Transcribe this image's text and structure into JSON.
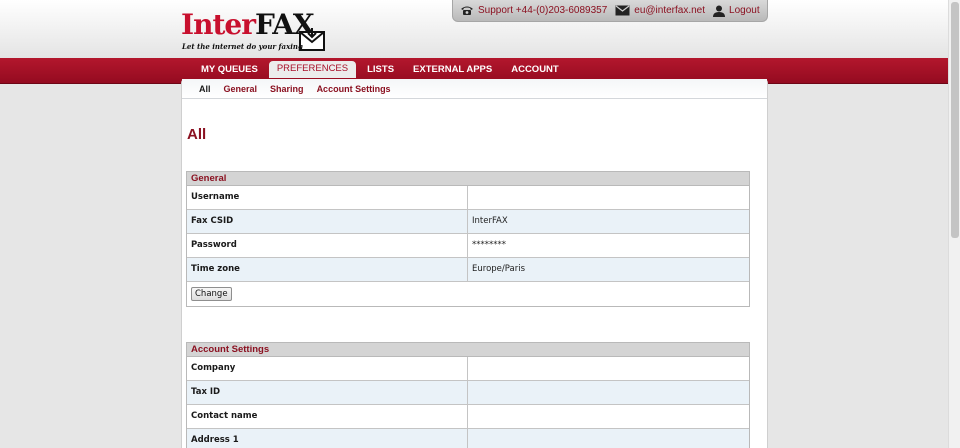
{
  "logo": {
    "word_red": "Inter",
    "word_black": "FAX",
    "tagline": "Let the internet do your faxing"
  },
  "contact": {
    "support": "Support +44-(0)203-6089357",
    "email": "eu@interfax.net",
    "logout": "Logout",
    "icons": [
      "phone-icon",
      "mail-icon",
      "user-icon"
    ]
  },
  "nav": {
    "tabs": [
      {
        "label": "MY QUEUES"
      },
      {
        "label": "PREFERENCES",
        "active": true
      },
      {
        "label": "LISTS"
      },
      {
        "label": "EXTERNAL APPS"
      },
      {
        "label": "ACCOUNT"
      }
    ]
  },
  "subnav": {
    "links": [
      {
        "label": "All",
        "current": true
      },
      {
        "label": "General"
      },
      {
        "label": "Sharing"
      },
      {
        "label": "Account Settings"
      }
    ]
  },
  "page": {
    "title": "All"
  },
  "general": {
    "heading": "General",
    "rows": [
      {
        "label": "Username",
        "value": ""
      },
      {
        "label": "Fax CSID",
        "value": "InterFAX"
      },
      {
        "label": "Password",
        "value": "********"
      },
      {
        "label": "Time zone",
        "value": "Europe/Paris"
      }
    ],
    "button": "Change"
  },
  "account_settings": {
    "heading": "Account Settings",
    "rows": [
      {
        "label": "Company",
        "value": ""
      },
      {
        "label": "Tax ID",
        "value": ""
      },
      {
        "label": "Contact name",
        "value": ""
      },
      {
        "label": "Address 1",
        "value": ""
      }
    ]
  },
  "colors": {
    "brand_red": "#b3172d",
    "link_red": "#8b1121",
    "row_alt": "#eaf2f8"
  }
}
